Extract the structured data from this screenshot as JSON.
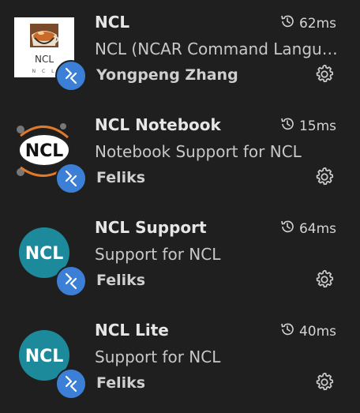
{
  "extensions": [
    {
      "name": "NCL",
      "description": "NCL (NCAR Command Language) ...",
      "author": "Yongpeng Zhang",
      "activation_time": "62ms",
      "icon": "ncl-coffee-logo-icon"
    },
    {
      "name": "NCL Notebook",
      "description": "Notebook Support for NCL",
      "author": "Feliks",
      "activation_time": "15ms",
      "icon": "ncl-oval-logo-icon"
    },
    {
      "name": "NCL Support",
      "description": "Support for NCL",
      "author": "Feliks",
      "activation_time": "64ms",
      "icon": "ncl-teal-circle-logo-icon"
    },
    {
      "name": "NCL Lite",
      "description": "Support for NCL",
      "author": "Feliks",
      "activation_time": "40ms",
      "icon": "ncl-teal-circle-logo-icon"
    }
  ],
  "logo_text": {
    "ncl": "NCL",
    "ncl_small": "N C L"
  },
  "colors": {
    "background": "#1f1f1f",
    "remote_badge": "#3c7fd6",
    "teal_logo": "#1d8a9c"
  }
}
